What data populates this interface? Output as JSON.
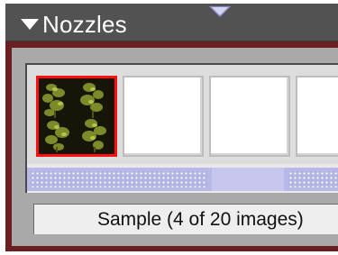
{
  "panel": {
    "title": "Nozzles",
    "collapse_icon": "triangle-down-icon",
    "colors": {
      "frame": "#6a1f22",
      "header": "#525252",
      "selection": "#ff1010",
      "scroller": "#b9b9e8"
    }
  },
  "tray": {
    "selected_index": 0,
    "selected_thumbnail": "foliage-nozzle-thumbnail",
    "scroll_icon": "scroll-down-arrow-icon"
  },
  "caption": {
    "text": "Sample (4 of 20  images)"
  }
}
